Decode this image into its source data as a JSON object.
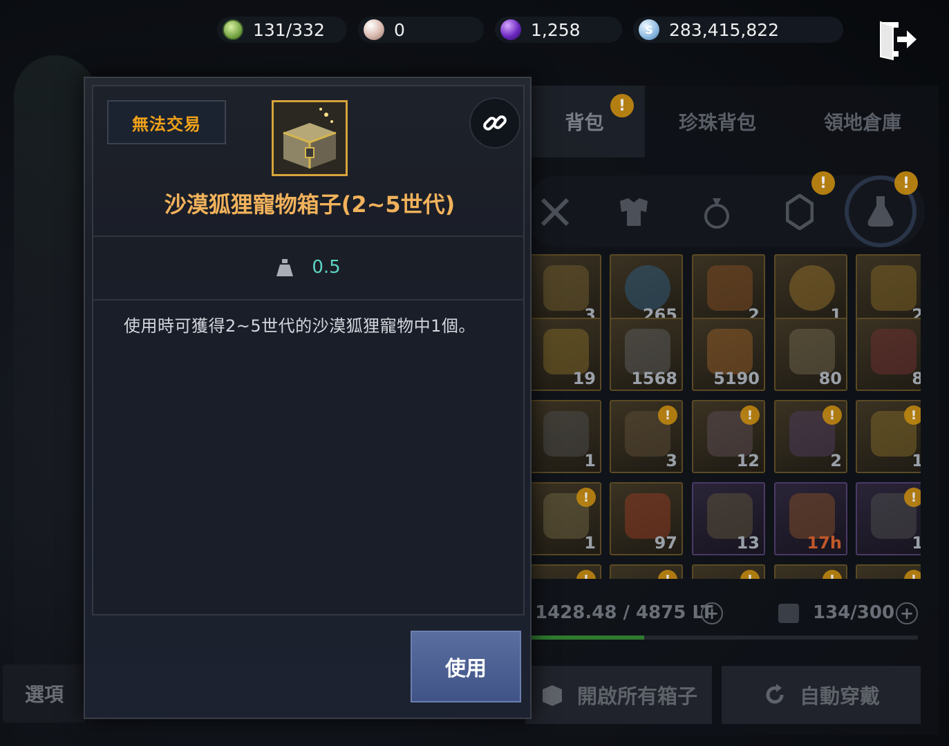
{
  "currencies": [
    {
      "icon": "energy-icon",
      "value": "131/332"
    },
    {
      "icon": "pearl-icon",
      "value": "0"
    },
    {
      "icon": "crystal-icon",
      "value": "1,258"
    },
    {
      "icon": "silver-icon",
      "value": "283,415,822"
    }
  ],
  "background": {
    "options_label": "選項"
  },
  "inventory": {
    "tabs": [
      {
        "label": "背包",
        "badge": "!"
      },
      {
        "label": "珍珠背包"
      },
      {
        "label": "領地倉庫"
      }
    ],
    "categories": [
      {
        "icon": "weapon-icon"
      },
      {
        "icon": "armor-icon"
      },
      {
        "icon": "accessory-icon"
      },
      {
        "icon": "crystal-gem-icon",
        "badge": "!"
      },
      {
        "icon": "potion-icon",
        "badge": "!",
        "selected": true
      }
    ],
    "slots": [
      {
        "count": "3"
      },
      {
        "count": "265"
      },
      {
        "count": "2"
      },
      {
        "count": "1"
      },
      {
        "count": "2"
      },
      {
        "count": "19"
      },
      {
        "count": "1568"
      },
      {
        "count": "5190"
      },
      {
        "count": "80"
      },
      {
        "count": "8"
      },
      {
        "count": "1"
      },
      {
        "count": "3"
      },
      {
        "count": "12"
      },
      {
        "count": "2"
      },
      {
        "count": "1"
      },
      {
        "count": "1"
      },
      {
        "count": "97"
      },
      {
        "count": "13"
      },
      {
        "count": "17h"
      },
      {
        "count": "1"
      }
    ],
    "weight_text": "1428.48 / 4875 LT",
    "weight_fraction": 0.293,
    "slots_text": "134/300",
    "open_all_label": "開啟所有箱子",
    "auto_equip_label": "自動穿戴"
  },
  "tooltip": {
    "trade_status": "無法交易",
    "item_name": "沙漠狐狸寵物箱子(2~5世代)",
    "weight": "0.5",
    "description": "使用時可獲得2~5世代的沙漠狐狸寵物中1個。",
    "use_label": "使用"
  }
}
